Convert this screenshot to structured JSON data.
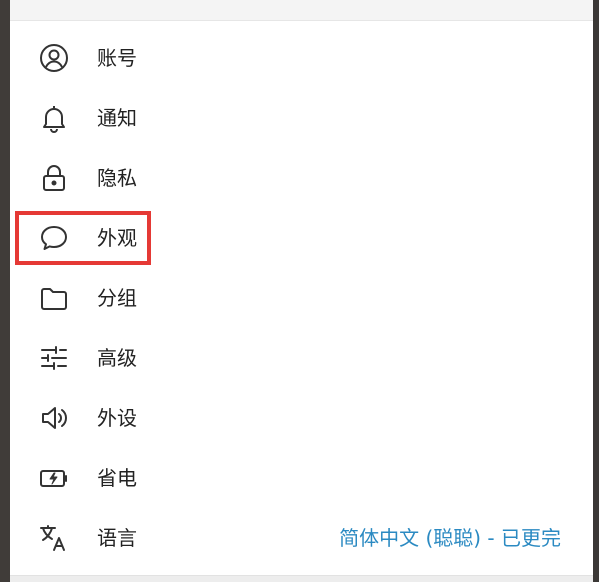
{
  "settings_menu": {
    "items": [
      {
        "label": "账号",
        "icon": "user-circle-icon"
      },
      {
        "label": "通知",
        "icon": "bell-icon"
      },
      {
        "label": "隐私",
        "icon": "lock-icon"
      },
      {
        "label": "外观",
        "icon": "chat-bubble-icon"
      },
      {
        "label": "分组",
        "icon": "folder-icon"
      },
      {
        "label": "高级",
        "icon": "sliders-icon"
      },
      {
        "label": "外设",
        "icon": "speaker-icon"
      },
      {
        "label": "省电",
        "icon": "battery-charging-icon"
      },
      {
        "label": "语言",
        "icon": "translate-icon",
        "value": "简体中文 (聪聪) - 已更完"
      }
    ],
    "highlighted_item": "外观",
    "highlight_color": "#e53935",
    "value_color": "#2b8ac2"
  }
}
